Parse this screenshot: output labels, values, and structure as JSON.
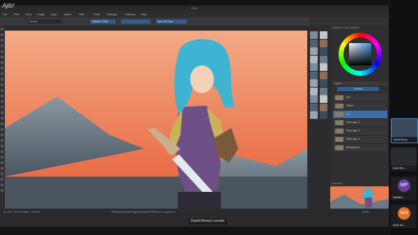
{
  "window": {
    "title": "Krita",
    "watermark": "Ajib!"
  },
  "menu": [
    "File",
    "Edit",
    "View",
    "Image",
    "Layer",
    "Select",
    "Filter",
    "Tools",
    "Settings",
    "Window",
    "Help"
  ],
  "tool_options": {
    "preset": "Normal",
    "opacity_label": "Opacity: 100%",
    "size_label": "Size: 60.00 px"
  },
  "canvas": {
    "sky_top": "#f0a27e",
    "sky_bottom": "#e8603c",
    "mountain": "#7c8e9a",
    "hair": "#3fb4d2",
    "tunic": "#6e4f86",
    "sleeve": "#c9b25a"
  },
  "docker": {
    "panel_title": "Advanced Color Selector",
    "layers_title": "Layers",
    "blend_mode": "Normal",
    "layers": [
      {
        "name": "Hat"
      },
      {
        "name": "Sketch"
      },
      {
        "name": "Ink"
      },
      {
        "name": "Paint layer 4"
      },
      {
        "name": "Paint layer 3"
      },
      {
        "name": "Paint layer 2"
      },
      {
        "name": "Background"
      }
    ],
    "preview_label": "Overview"
  },
  "statusbar": {
    "left": "Ink_Pen_Fine_Precision - Krita 5.2",
    "center": "RGB/Alpha (8-bit integer/channel) sRGB-elle-V2-srgbtrc.icc",
    "zoom": "50.0%"
  },
  "participants": [
    {
      "name": "David Revoy",
      "initials": "",
      "color": "#3a4a5a"
    },
    {
      "name": "David Rev...",
      "initials": "",
      "color": "#2a2c30"
    },
    {
      "name": "Madeline ...",
      "initials": "MP",
      "color": "#6a3f9a"
    },
    {
      "name": "Marie Nor...",
      "initials": "MN",
      "color": "#e0722a"
    }
  ],
  "share_label": "David Revoy's screen"
}
